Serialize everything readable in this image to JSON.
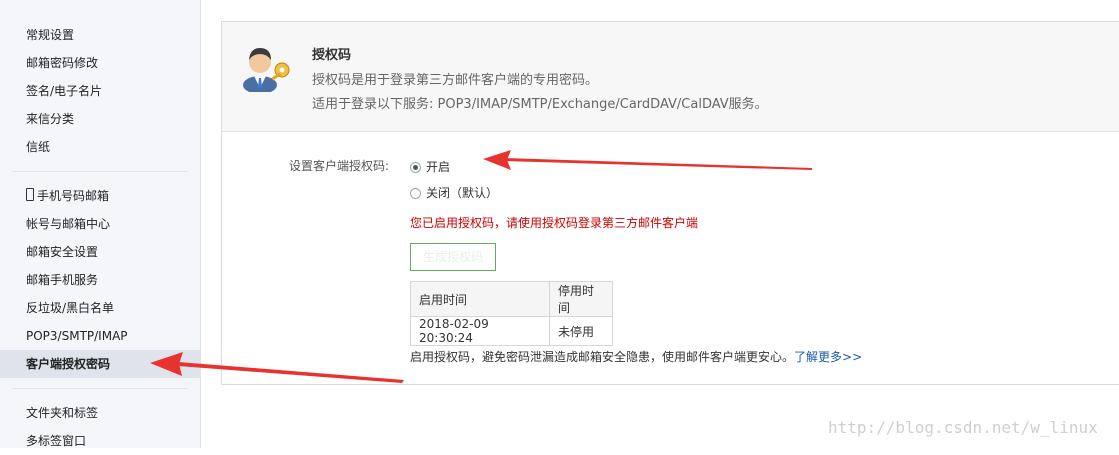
{
  "sidebar": {
    "items": [
      {
        "label": "常规设置"
      },
      {
        "label": "邮箱密码修改"
      },
      {
        "label": "签名/电子名片"
      },
      {
        "label": "来信分类"
      },
      {
        "label": "信纸"
      },
      {
        "label": "手机号码邮箱"
      },
      {
        "label": "帐号与邮箱中心"
      },
      {
        "label": "邮箱安全设置"
      },
      {
        "label": "邮箱手机服务"
      },
      {
        "label": "反垃圾/黑白名单"
      },
      {
        "label": "POP3/SMTP/IMAP"
      },
      {
        "label": "客户端授权密码",
        "active": true
      },
      {
        "label": "文件夹和标签"
      },
      {
        "label": "多标签窗口"
      }
    ]
  },
  "header": {
    "title": "授权码",
    "desc1": "授权码是用于登录第三方邮件客户端的专用密码。",
    "desc2": "适用于登录以下服务: POP3/IMAP/SMTP/Exchange/CardDAV/CalDAV服务。",
    "icon": "user-key-icon"
  },
  "form": {
    "label": "设置客户端授权码:",
    "option_on": "开启",
    "option_off": "关闭（默认）",
    "selected": "开启",
    "notice": "您已启用授权码，请使用授权码登录第三方邮件客户端",
    "generate_button": "生成授权码"
  },
  "table": {
    "headers": [
      "启用时间",
      "停用时间"
    ],
    "rows": [
      [
        "2018-02-09 20:30:24",
        "未停用"
      ]
    ]
  },
  "footer": {
    "tip": "启用授权码，避免密码泄漏造成邮箱安全隐患，使用邮件客户端更安心。",
    "link": "了解更多>>"
  },
  "watermark": "http://blog.csdn.net/w_linux",
  "colors": {
    "arrow": "#e8322e",
    "notice": "#cc0000",
    "link": "#1a5aa8",
    "sidebar_bg": "#f4f6f9",
    "active_bg": "#dfe4ec"
  }
}
